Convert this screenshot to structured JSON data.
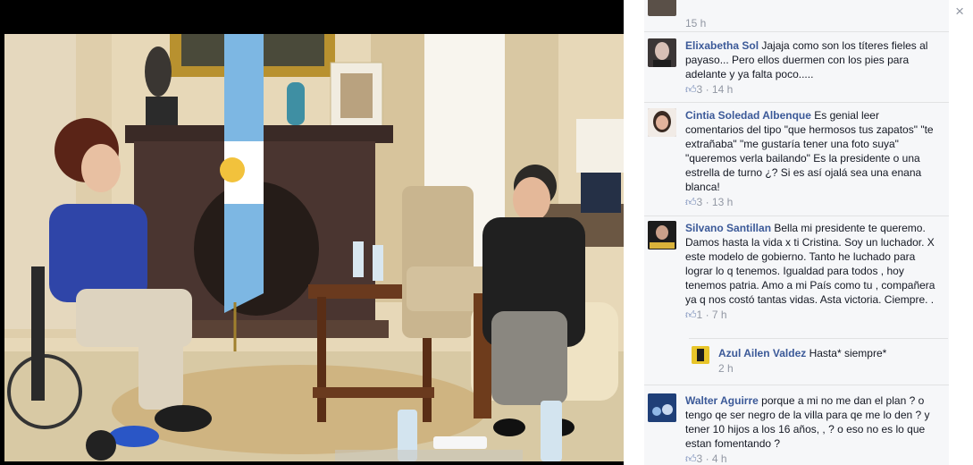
{
  "top_fragment": {
    "time": "15 h"
  },
  "close_label": "×",
  "comments": [
    {
      "name": "Elixabetha Sol",
      "text": "Jajaja como son los títeres fieles al payaso... Pero ellos duermen con los pies para adelante y ya falta poco.....",
      "likes": "3",
      "time": "14 h"
    },
    {
      "name": "Cintia Soledad Albenque",
      "text": "Es genial leer comentarios del tipo \"que hermosos tus zapatos\" \"te extrañaba\" \"me gustaría tener una foto suya\" \"queremos verla bailando\" Es la presidente o una estrella de turno ¿? Si es así ojalá sea una enana blanca!",
      "likes": "3",
      "time": "13 h"
    },
    {
      "name": "Silvano Santillan",
      "text": "Bella mi presidente te queremo. Damos hasta la vida x ti Cristina. Soy un luchador. X este modelo de gobierno. Tanto he luchado para lograr lo q tenemos. Igualdad para todos , hoy tenemos patria. Amo a mi País como tu , compañera ya q nos costó tantas vidas. Asta victoria. Ciempre. .",
      "likes": "1",
      "time": "7 h"
    },
    {
      "name": "Walter Aguirre",
      "text": "porque a mi no me dan el plan ? o tengo qe ser negro de la villa para qe me lo den ? y tener 10 hijos a los 16 años, , ? o eso no es lo que estan fomentando ?",
      "likes": "3",
      "time": "4 h"
    }
  ],
  "reply": {
    "name": "Azul Ailen Valdez",
    "text": "Hasta* siempre*",
    "time": "2 h"
  },
  "like_icon": "thumbs-up-icon",
  "colors": {
    "link": "#3b5998",
    "meta": "#9197a3",
    "panel": "#f6f7f9"
  }
}
